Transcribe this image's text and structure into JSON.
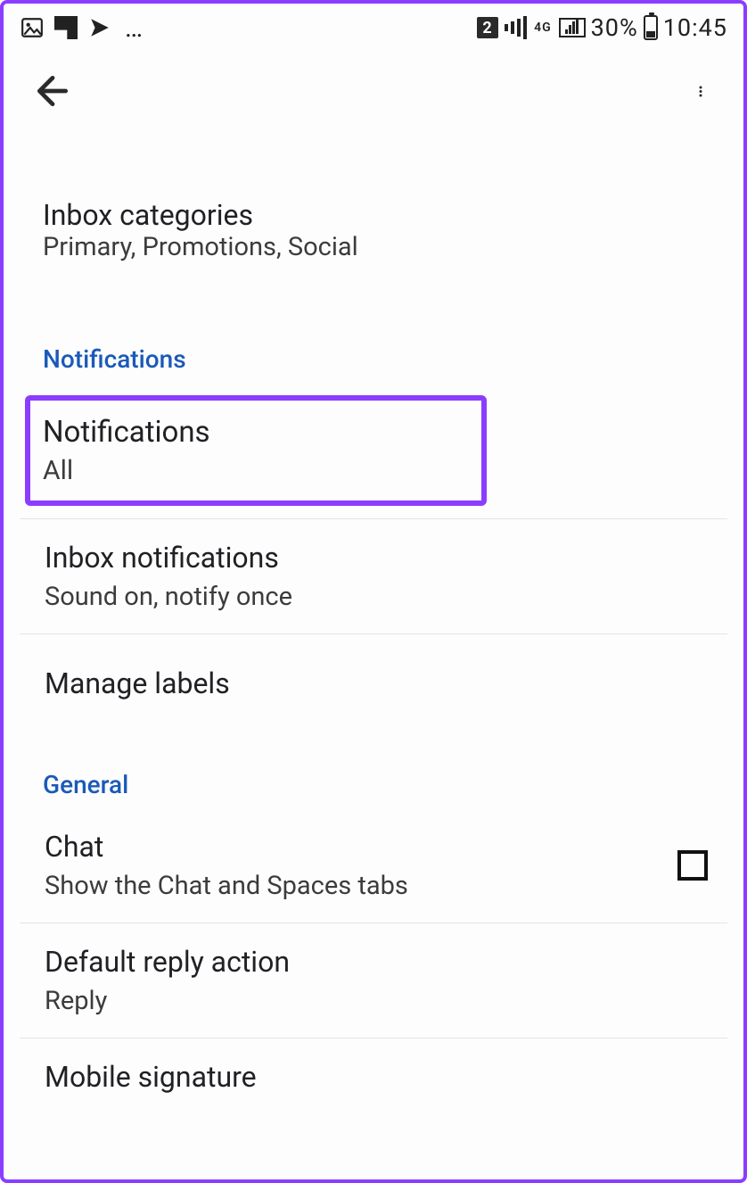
{
  "status": {
    "sim_badge": "2",
    "network_label": "4G",
    "battery_percent": "30%",
    "clock": "10:45"
  },
  "settings": {
    "inbox_categories": {
      "title": "Inbox categories",
      "subtitle": "Primary, Promotions, Social"
    },
    "section_notifications": "Notifications",
    "notifications": {
      "title": "Notifications",
      "subtitle": "All"
    },
    "inbox_notifications": {
      "title": "Inbox notifications",
      "subtitle": "Sound on, notify once"
    },
    "manage_labels": {
      "title": "Manage labels"
    },
    "section_general": "General",
    "chat": {
      "title": "Chat",
      "subtitle": "Show the Chat and Spaces tabs"
    },
    "default_reply": {
      "title": "Default reply action",
      "subtitle": "Reply"
    },
    "mobile_signature": {
      "title": "Mobile signature"
    }
  }
}
